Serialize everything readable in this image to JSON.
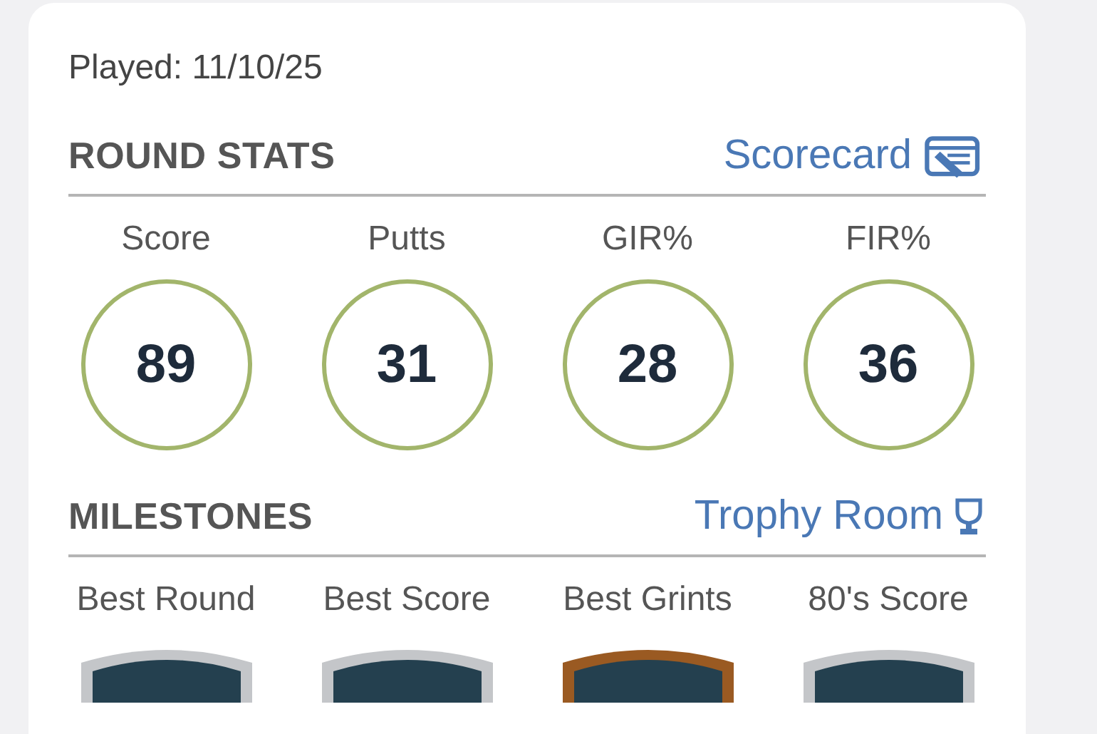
{
  "played": "Played: 11/10/25",
  "round_stats": {
    "title": "ROUND STATS",
    "link": "Scorecard",
    "stats": [
      {
        "label": "Score",
        "value": "89"
      },
      {
        "label": "Putts",
        "value": "31"
      },
      {
        "label": "GIR%",
        "value": "28"
      },
      {
        "label": "FIR%",
        "value": "36"
      }
    ]
  },
  "milestones": {
    "title": "MILESTONES",
    "link": "Trophy Room",
    "items": [
      {
        "label": "Best Round",
        "color": "#c4c6c9"
      },
      {
        "label": "Best Score",
        "color": "#c4c6c9"
      },
      {
        "label": "Best Grints",
        "color": "#9a5a22"
      },
      {
        "label": "80's Score",
        "color": "#c4c6c9"
      }
    ]
  }
}
